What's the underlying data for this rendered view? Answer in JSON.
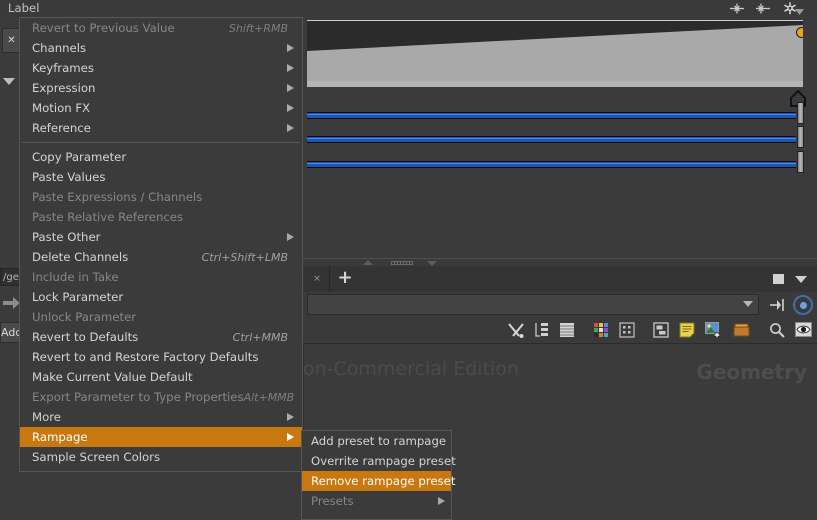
{
  "app": {
    "param_label": "Label",
    "watermark_left": "on-Commercial Edition",
    "watermark_right": "Geometry",
    "node_path_value": "",
    "node_path_placeholder": "",
    "geo_field_value": "/geo",
    "add_button_label": "Add",
    "accent_color": "#c8780f",
    "slider_color": "#1f57b4",
    "knot_color": "#e8a41a"
  },
  "header_icons": [
    {
      "name": "keyframe-set-icon"
    },
    {
      "name": "keyframe-next-icon"
    },
    {
      "name": "gear-icon"
    }
  ],
  "tabbar": {
    "close_label": "×",
    "add_label": "+"
  },
  "node_toolbar": [
    {
      "name": "tools-icon"
    },
    {
      "name": "tree-view-icon"
    },
    {
      "name": "list-view-icon"
    },
    {
      "name": "color-palette-icon"
    },
    {
      "name": "grid-dots-icon"
    },
    {
      "name": "layout-panes-icon"
    },
    {
      "name": "sticky-note-icon"
    },
    {
      "name": "add-image-icon"
    },
    {
      "name": "box-icon"
    },
    {
      "name": "search-icon"
    },
    {
      "name": "visibility-icon"
    }
  ],
  "context_menu": {
    "items": [
      {
        "label": "Revert to Previous Value",
        "shortcut": "Shift+RMB",
        "disabled": true,
        "submenu": false,
        "selected": false
      },
      {
        "label": "Channels",
        "shortcut": "",
        "disabled": false,
        "submenu": true,
        "selected": false
      },
      {
        "label": "Keyframes",
        "shortcut": "",
        "disabled": false,
        "submenu": true,
        "selected": false
      },
      {
        "label": "Expression",
        "shortcut": "",
        "disabled": false,
        "submenu": true,
        "selected": false
      },
      {
        "label": "Motion FX",
        "shortcut": "",
        "disabled": false,
        "submenu": true,
        "selected": false
      },
      {
        "label": "Reference",
        "shortcut": "",
        "disabled": false,
        "submenu": true,
        "selected": false
      },
      {
        "separator": true
      },
      {
        "label": "Copy Parameter",
        "shortcut": "",
        "disabled": false,
        "submenu": false,
        "selected": false
      },
      {
        "label": "Paste Values",
        "shortcut": "",
        "disabled": false,
        "submenu": false,
        "selected": false
      },
      {
        "label": "Paste Expressions / Channels",
        "shortcut": "",
        "disabled": true,
        "submenu": false,
        "selected": false
      },
      {
        "label": "Paste Relative References",
        "shortcut": "",
        "disabled": true,
        "submenu": false,
        "selected": false
      },
      {
        "label": "Paste Other",
        "shortcut": "",
        "disabled": false,
        "submenu": true,
        "selected": false
      },
      {
        "label": "Delete Channels",
        "shortcut": "Ctrl+Shift+LMB",
        "disabled": false,
        "submenu": false,
        "selected": false
      },
      {
        "label": "Include in Take",
        "shortcut": "",
        "disabled": true,
        "submenu": false,
        "selected": false
      },
      {
        "label": "Lock Parameter",
        "shortcut": "",
        "disabled": false,
        "submenu": false,
        "selected": false
      },
      {
        "label": "Unlock Parameter",
        "shortcut": "",
        "disabled": true,
        "submenu": false,
        "selected": false
      },
      {
        "label": "Revert to Defaults",
        "shortcut": "Ctrl+MMB",
        "disabled": false,
        "submenu": false,
        "selected": false
      },
      {
        "label": "Revert to and Restore Factory Defaults",
        "shortcut": "",
        "disabled": false,
        "submenu": false,
        "selected": false
      },
      {
        "label": "Make Current Value Default",
        "shortcut": "",
        "disabled": false,
        "submenu": false,
        "selected": false
      },
      {
        "label": "Export Parameter to Type Properties",
        "shortcut": "Alt+MMB",
        "disabled": true,
        "submenu": false,
        "selected": false
      },
      {
        "label": "More",
        "shortcut": "",
        "disabled": false,
        "submenu": true,
        "selected": false
      },
      {
        "label": "Rampage",
        "shortcut": "",
        "disabled": false,
        "submenu": true,
        "selected": true
      },
      {
        "label": "Sample Screen Colors",
        "shortcut": "",
        "disabled": false,
        "submenu": false,
        "selected": false
      }
    ]
  },
  "sub_menu": {
    "items": [
      {
        "label": "Add preset to rampage",
        "shortcut": "",
        "disabled": false,
        "submenu": false,
        "selected": false
      },
      {
        "label": "Overrite rampage preset",
        "shortcut": "",
        "disabled": false,
        "submenu": false,
        "selected": false
      },
      {
        "label": "Remove rampage preset",
        "shortcut": "",
        "disabled": false,
        "submenu": false,
        "selected": true
      },
      {
        "label": "Presets",
        "shortcut": "",
        "disabled": true,
        "submenu": true,
        "selected": false
      }
    ]
  }
}
